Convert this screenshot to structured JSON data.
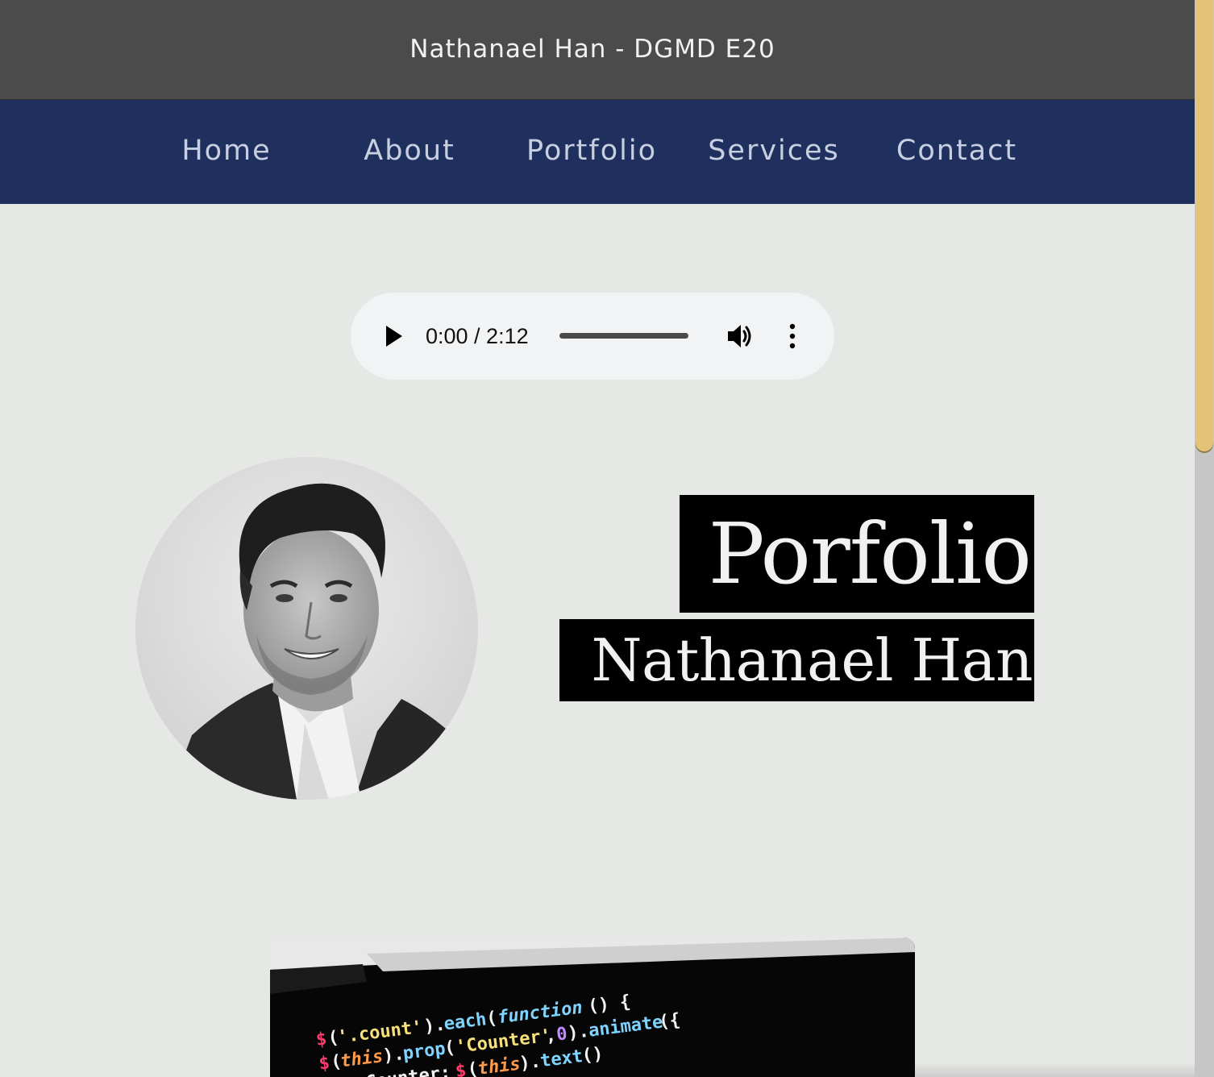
{
  "header": {
    "title": "Nathanael Han - DGMD E20"
  },
  "nav": {
    "items": [
      {
        "label": "Home"
      },
      {
        "label": "About"
      },
      {
        "label": "Portfolio"
      },
      {
        "label": "Services"
      },
      {
        "label": "Contact"
      }
    ]
  },
  "audio": {
    "time_display": "0:00 / 2:12",
    "progress": 0,
    "icons": [
      "play-icon",
      "volume-icon",
      "more-options-icon"
    ]
  },
  "hero": {
    "title": "Porfolio",
    "name": "Nathanael Han"
  },
  "colors": {
    "header_bg": "#4b4b4b",
    "nav_bg": "#1f305e",
    "nav_text": "#c8cfe0",
    "page_bg": "#e6e8e5",
    "scroll_thumb": "#e3c477",
    "hero_bg": "#000000",
    "hero_text": "#f1f1f1"
  }
}
